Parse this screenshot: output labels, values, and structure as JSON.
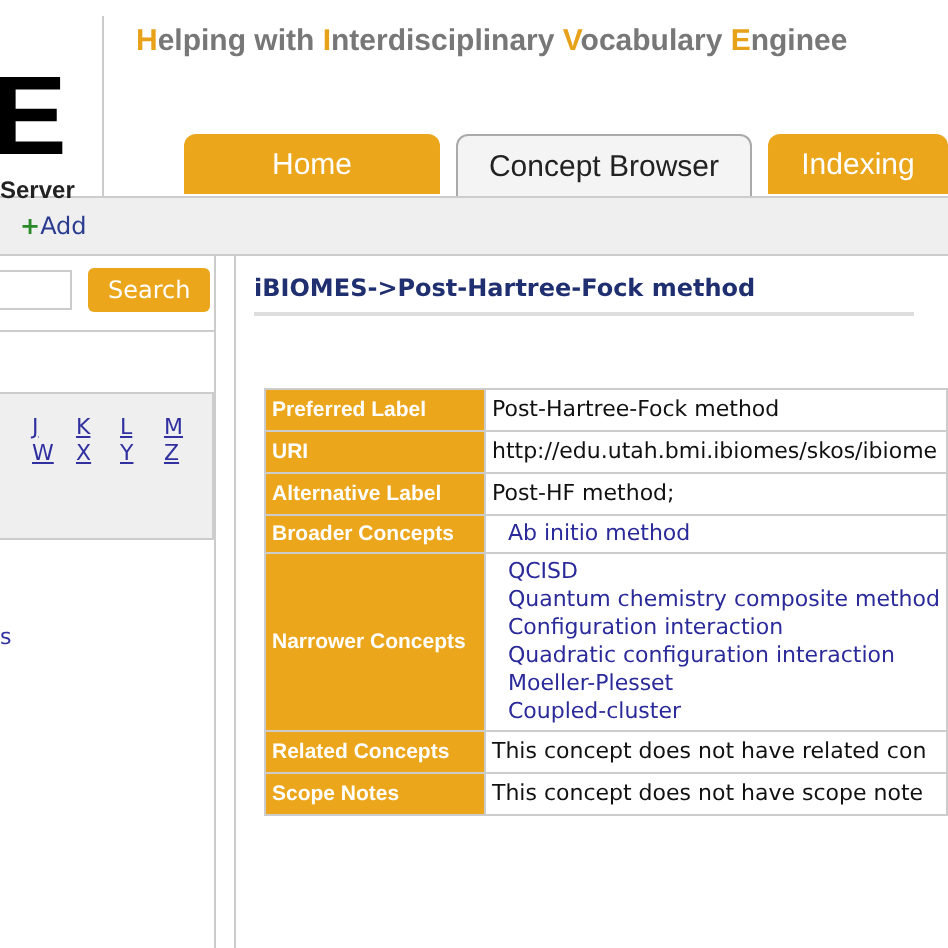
{
  "header": {
    "logo_letter": "E",
    "logo_caption": "Server",
    "title": [
      {
        "text": "H",
        "highlight": true
      },
      {
        "text": "elping with ",
        "highlight": false
      },
      {
        "text": "I",
        "highlight": true
      },
      {
        "text": "nterdisciplinary ",
        "highlight": false
      },
      {
        "text": "V",
        "highlight": true
      },
      {
        "text": "ocabulary ",
        "highlight": false
      },
      {
        "text": "E",
        "highlight": true
      },
      {
        "text": "nginee",
        "highlight": false
      }
    ]
  },
  "tabs": [
    {
      "label": "Home",
      "selected": false
    },
    {
      "label": "Concept Browser",
      "selected": true
    },
    {
      "label": "Indexing",
      "selected": false
    }
  ],
  "toolbar": {
    "add_icon": "+",
    "add_label": "Add"
  },
  "sidebar": {
    "search_button": "Search",
    "letters": [
      [
        "J",
        "K",
        "L",
        "M"
      ],
      [
        "W",
        "X",
        "Y",
        "Z"
      ]
    ],
    "cut_text": "s"
  },
  "breadcrumb": "iBIOMES->Post-Hartree-Fock method",
  "concept": [
    {
      "label": "Preferred Label",
      "kind": "text",
      "values": [
        "Post-Hartree-Fock method"
      ]
    },
    {
      "label": "URI",
      "kind": "text",
      "values": [
        "http://edu.utah.bmi.ibiomes/skos/ibiome"
      ]
    },
    {
      "label": "Alternative Label",
      "kind": "text",
      "values": [
        "Post-HF method;"
      ]
    },
    {
      "label": "Broader Concepts",
      "kind": "links",
      "values": [
        "Ab initio method"
      ]
    },
    {
      "label": "Narrower Concepts",
      "kind": "links",
      "values": [
        "QCISD",
        "Quantum chemistry composite method",
        "Configuration interaction",
        "Quadratic configuration interaction",
        "Moeller-Plesset",
        "Coupled-cluster"
      ]
    },
    {
      "label": "Related Concepts",
      "kind": "text",
      "values": [
        "This concept does not have related con"
      ]
    },
    {
      "label": "Scope Notes",
      "kind": "text",
      "values": [
        "This concept does not have scope note"
      ]
    }
  ]
}
